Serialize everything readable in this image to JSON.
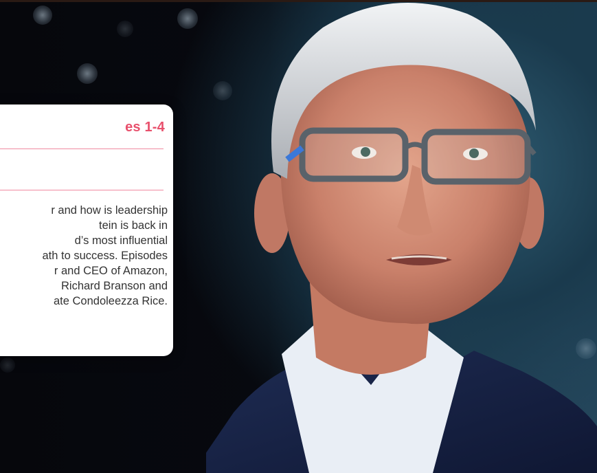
{
  "card": {
    "title": "es 1-4",
    "description_lines": [
      "r and how is leadership",
      "tein is back in",
      "d’s most influential",
      "ath to success. Episodes",
      "r and CEO of Amazon,",
      "Richard Branson and",
      "ate Condoleezza Rice."
    ]
  },
  "colors": {
    "accent": "#e8506c",
    "divider": "#f08aa0",
    "card_bg": "#ffffff",
    "text": "#333333",
    "background_dark": "#050812",
    "background_teal": "#2f5d73"
  },
  "icons": []
}
